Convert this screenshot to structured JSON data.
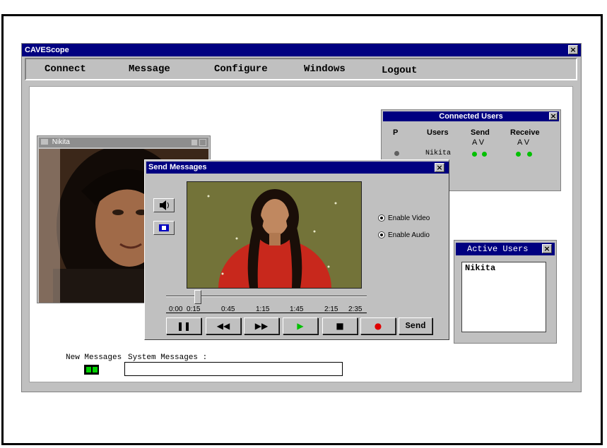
{
  "app": {
    "title": "CAVEScope"
  },
  "menu": {
    "items": [
      "Connect",
      "Message",
      "Configure",
      "Windows",
      "Logout"
    ]
  },
  "video_window": {
    "title": "Nikita"
  },
  "connected_users": {
    "title": "Connected Users",
    "headers": {
      "p": "P",
      "users": "Users",
      "send": "Send",
      "receive": "Receive"
    },
    "sub_headers": {
      "send": "A V",
      "receive": "A V"
    },
    "rows": [
      {
        "user": "Nikita"
      }
    ]
  },
  "active_users": {
    "title": "Active Users",
    "items": [
      "Nikita"
    ]
  },
  "send_messages": {
    "title": "Send Messages",
    "enable_video_label": "Enable Video",
    "enable_audio_label": "Enable Audio",
    "timeline_ticks": [
      "0:00",
      "0:15",
      "0:45",
      "1:15",
      "1:45",
      "2:15",
      "2:35"
    ],
    "playback_position": 0.16,
    "send_label": "Send"
  },
  "footer": {
    "new_messages_label": "New Messages",
    "system_messages_label": "System Messages :",
    "system_messages_value": ""
  },
  "colors": {
    "titlebar": "#000080",
    "window": "#c0c0c0",
    "led_green": "#00c000",
    "record_red": "#e00000",
    "play_green": "#00c000"
  }
}
